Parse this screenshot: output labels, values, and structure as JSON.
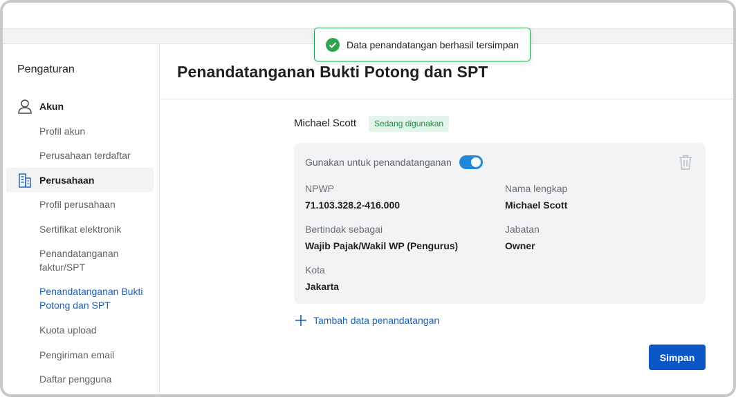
{
  "toast": {
    "message": "Data penandatangan berhasil tersimpan"
  },
  "sidebar": {
    "title": "Pengaturan",
    "groups": [
      {
        "label": "Akun",
        "icon": "user-icon"
      },
      {
        "label": "Perusahaan",
        "icon": "building-icon"
      }
    ],
    "items": [
      "Profil akun",
      "Perusahaan terdaftar",
      "Profil perusahaan",
      "Sertifikat elektronik",
      "Penandatanganan faktur/SPT",
      "Penandatanganan Bukti Potong dan SPT",
      "Kuota upload",
      "Pengiriman email",
      "Daftar pengguna"
    ],
    "selected_item": "Penandatanganan Bukti Potong dan SPT"
  },
  "main": {
    "title": "Penandatanganan Bukti Potong dan SPT",
    "signer": {
      "name": "Michael Scott",
      "badge": "Sedang digunakan",
      "use_label": "Gunakan untuk penandatanganan",
      "use_enabled": true,
      "fields": {
        "npwp_label": "NPWP",
        "npwp_value": "71.103.328.2-416.000",
        "nama_label": "Nama lengkap",
        "nama_value": "Michael Scott",
        "bertindak_label": "Bertindak sebagai",
        "bertindak_value": "Wajib Pajak/Wakil WP (Pengurus)",
        "jabatan_label": "Jabatan",
        "jabatan_value": "Owner",
        "kota_label": "Kota",
        "kota_value": "Jakarta"
      }
    },
    "add_link": "Tambah data penandatangan",
    "save_button": "Simpan"
  },
  "colors": {
    "accent": "#0b57c8",
    "link": "#1a5fb4",
    "toggle_on": "#1e88d9",
    "badge_bg": "#e3f4ea",
    "badge_text": "#1e8e3e",
    "success": "#2da44e"
  }
}
